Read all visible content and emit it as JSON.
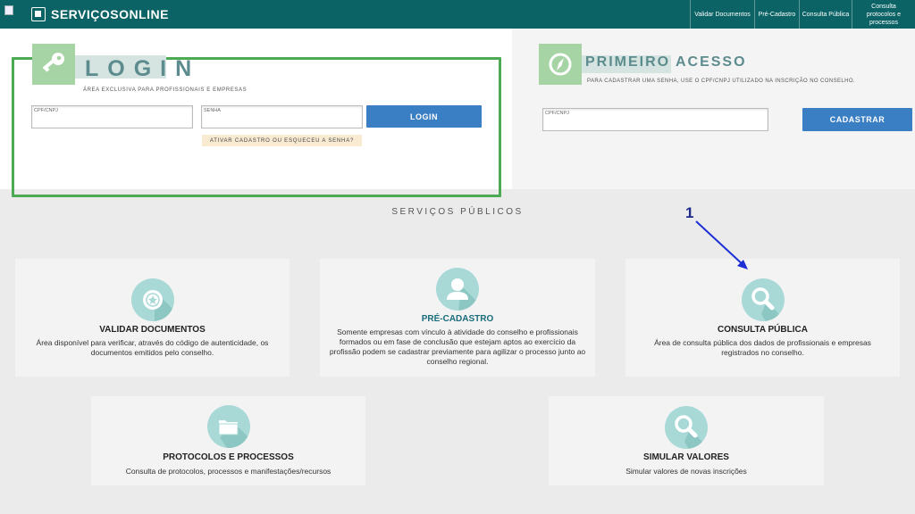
{
  "header": {
    "logo_text": "SERVIÇOSONLINE",
    "nav": [
      "Validar Documentos",
      "Pré-Cadastro",
      "Consulta Pública",
      "Consulta protocolos e processos"
    ]
  },
  "login": {
    "title": "LOGIN",
    "subtitle": "ÁREA EXCLUSIVA PARA PROFISSIONAIS E EMPRESAS",
    "cpf_label": "CPF/CNPJ",
    "senha_label": "SENHA",
    "button": "LOGIN",
    "forgot": "ATIVAR CADASTRO OU ESQUECEU A SENHA?"
  },
  "access": {
    "title": "PRIMEIRO ACESSO",
    "subtitle": "PARA CADASTRAR UMA SENHA, USE O CPF/CNPJ UTILIZADO NA INSCRIÇÃO NO CONSELHO.",
    "cpf_label": "CPF/CNPJ",
    "button": "CADASTRAR"
  },
  "services": {
    "title": "SERVIÇOS PÚBLICOS",
    "cards": [
      {
        "title": "VALIDAR DOCUMENTOS",
        "desc": "Área disponível para verificar, através do código de autenticidade, os documentos emitidos pelo conselho."
      },
      {
        "title": "PRÉ-CADASTRO",
        "desc": "Somente empresas com vínculo à atividade do conselho e profissionais formados ou em fase de conclusão que estejam aptos ao exercício da profissão podem se cadastrar previamente para agilizar o processo junto ao conselho regional."
      },
      {
        "title": "CONSULTA PÚBLICA",
        "desc": "Área de consulta pública dos dados de profissionais e empresas registrados no conselho."
      },
      {
        "title": "PROTOCOLOS E PROCESSOS",
        "desc": "Consulta de protocolos, processos e manifestações/recursos"
      },
      {
        "title": "SIMULAR VALORES",
        "desc": "Simular valores de novas inscrições"
      }
    ]
  },
  "annotation": {
    "number": "1"
  },
  "colors": {
    "header": "#0b6365",
    "accent_green": "#4caa53",
    "button_blue": "#3a7ec4"
  }
}
